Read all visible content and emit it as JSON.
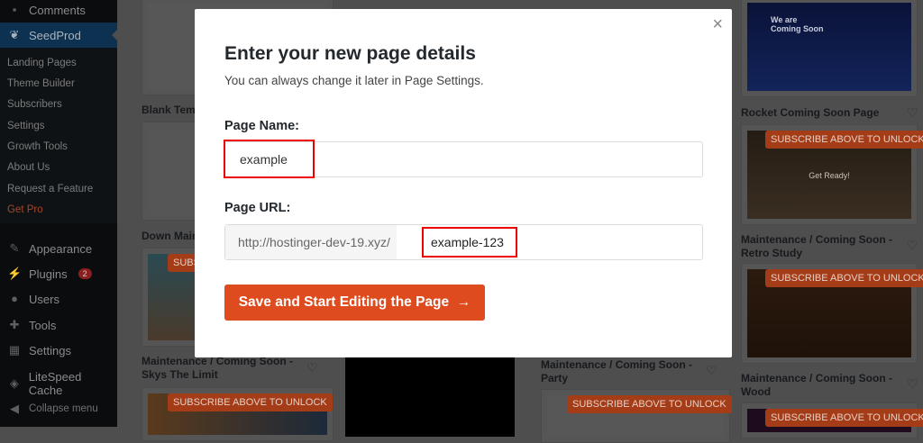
{
  "sidebar": {
    "comments": "Comments",
    "seedprod": "SeedProd",
    "submenu": [
      "Landing Pages",
      "Theme Builder",
      "Subscribers",
      "Settings",
      "Growth Tools",
      "About Us",
      "Request a Feature",
      "Get Pro"
    ],
    "appearance": "Appearance",
    "plugins": "Plugins",
    "plugins_badge": "2",
    "users": "Users",
    "tools": "Tools",
    "settings": "Settings",
    "litespeed": "LiteSpeed Cache",
    "collapse": "Collapse menu"
  },
  "templates": {
    "t1": "Blank Temp",
    "t2": "Down Main",
    "t3": "Maintenance / Coming Soon - Skys The Limit",
    "t4": "Maintenance / Coming Soon - Party",
    "t5": "Rocket Coming Soon Page",
    "t6": "Maintenance / Coming Soon - Retro Study",
    "t7": "Maintenance / Coming Soon - Wood",
    "rocket_heading": "We are Coming Soon",
    "subscribe": "SUBSCRIBE ABOVE TO UNLOCK",
    "get_ready": "Get Ready!",
    "logo": "SeedProd"
  },
  "modal": {
    "title": "Enter your new page details",
    "subtitle": "You can always change it later in Page Settings.",
    "name_label": "Page Name:",
    "name_value": "example",
    "url_label": "Page URL:",
    "url_prefix": "http://hostinger-dev-19.xyz/",
    "url_value": "example-123",
    "save_label": "Save and Start Editing the Page",
    "save_arrow": "→",
    "close": "×"
  },
  "colors": {
    "accent": "#dd4b1e",
    "highlight": "#ee0000"
  }
}
